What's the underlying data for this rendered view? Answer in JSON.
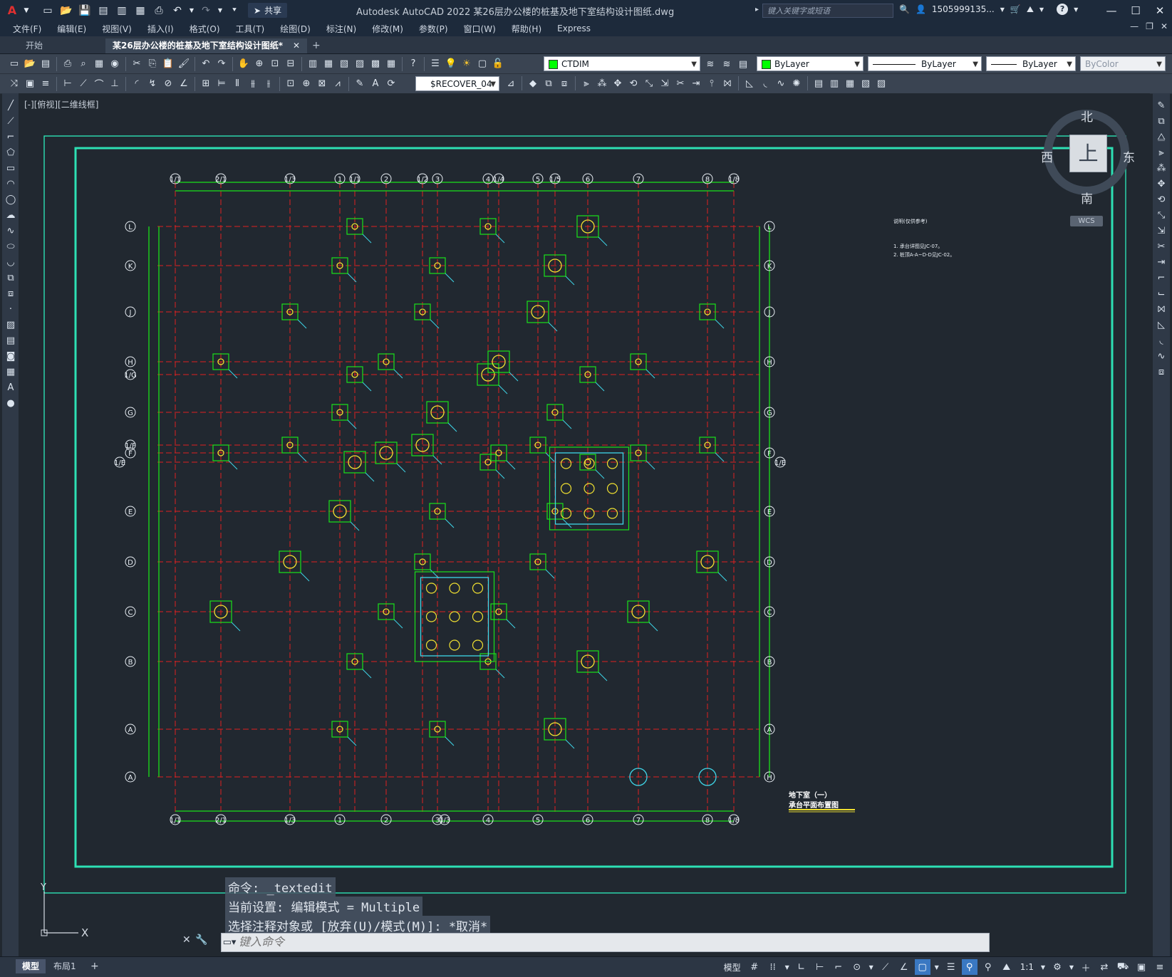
{
  "app": {
    "title": "Autodesk AutoCAD 2022    某26层办公楼的桩基及地下室结构设计图纸.dwg",
    "share_label": "共享",
    "search_placeholder": "键入关键字或短语",
    "user": "1505999135...",
    "help": "?"
  },
  "menu": [
    "文件(F)",
    "编辑(E)",
    "视图(V)",
    "插入(I)",
    "格式(O)",
    "工具(T)",
    "绘图(D)",
    "标注(N)",
    "修改(M)",
    "参数(P)",
    "窗口(W)",
    "帮助(H)",
    "Express"
  ],
  "tabs": {
    "start": "开始",
    "active": "某26层办公楼的桩基及地下室结构设计图纸*",
    "close": "✕",
    "add": "+"
  },
  "toolbar": {
    "layer": "CTDIM",
    "layer_color": "#00ff00",
    "color": "ByLayer",
    "linetype": "ByLayer",
    "lineweight": "ByLayer",
    "plotstyle": "ByColor",
    "dimstyle": "$RECOVER_04"
  },
  "viewport": {
    "label": "[-][俯视][二维线框]",
    "cube": {
      "north": "北",
      "south": "南",
      "east": "东",
      "west": "西",
      "face": "上",
      "wcs": "WCS"
    }
  },
  "drawing": {
    "notes": [
      "说明(仅供参考)",
      "1. 承台详图见JC-07。",
      "2. 桩顶A-A~D-D见JC-02。"
    ],
    "title_lines": [
      "地下室（一）",
      "承台平面布置图"
    ],
    "top_axes": [
      "1/1",
      "2/1",
      "1/3",
      "1",
      "1/1",
      "2",
      "1/2",
      "3",
      "4",
      "1/4",
      "5",
      "1/5",
      "6",
      "7",
      "8",
      "1/8"
    ],
    "bottom_axes": [
      "1/1",
      "2/1",
      "1/3",
      "1",
      "2",
      "3",
      "1/3",
      "4",
      "5",
      "6",
      "7",
      "8",
      "1/8"
    ],
    "left_axes": [
      "L",
      "K",
      "J",
      "H",
      "1/G",
      "G",
      "1/F",
      "F",
      "1/E",
      "E",
      "D",
      "C",
      "B",
      "A",
      "A"
    ],
    "right_axes": [
      "L",
      "K",
      "J",
      "H",
      "G",
      "F",
      "1/E",
      "E",
      "D",
      "C",
      "B",
      "A",
      "H"
    ]
  },
  "command": {
    "history": [
      "命令: _textedit",
      "当前设置: 编辑模式 = Multiple",
      "选择注释对象或 [放弃(U)/模式(M)]: *取消*"
    ],
    "placeholder": "键入命令"
  },
  "status": {
    "layout_tabs": [
      "模型",
      "布局1"
    ],
    "add": "+",
    "model_label": "模型",
    "scale": "1:1"
  },
  "colors": {
    "accent": "#3a78c2",
    "frame": "#2de0b4",
    "grid_red": "#e02020",
    "green": "#19e219",
    "cyan": "#3fd6e8",
    "yellow": "#f0e030"
  }
}
